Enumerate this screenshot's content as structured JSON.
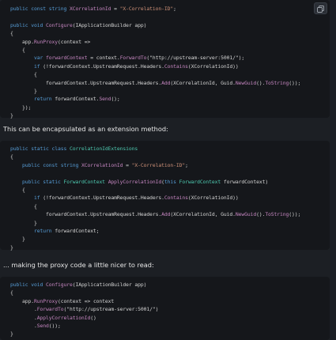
{
  "blocks": [
    {
      "lines": [
        [
          {
            "t": "public const string ",
            "k": "kw"
          },
          {
            "t": "XCorrelationId",
            "k": "member"
          },
          {
            "t": " = ",
            "k": "plain"
          },
          {
            "t": "\"X-Correlation-ID\"",
            "k": "str"
          },
          {
            "t": ";",
            "k": "plain"
          }
        ],
        [],
        [
          {
            "t": "public void ",
            "k": "kw"
          },
          {
            "t": "Configure",
            "k": "member"
          },
          {
            "t": "(IApplicationBuilder app)",
            "k": "plain"
          }
        ],
        [
          {
            "t": "{",
            "k": "plain"
          }
        ],
        [
          {
            "t": "    app.",
            "k": "plain"
          },
          {
            "t": "RunProxy",
            "k": "member"
          },
          {
            "t": "(context =>",
            "k": "plain"
          }
        ],
        [
          {
            "t": "    {",
            "k": "plain"
          }
        ],
        [
          {
            "t": "        var ",
            "k": "kw"
          },
          {
            "t": "forwardContext",
            "k": "member"
          },
          {
            "t": " = context.",
            "k": "plain"
          },
          {
            "t": "ForwardTo",
            "k": "member"
          },
          {
            "t": "(\"http://upstream-server:5001/\");",
            "k": "plain"
          }
        ],
        [
          {
            "t": "        if ",
            "k": "kw"
          },
          {
            "t": "(!forwardContext.UpstreamRequest.Headers.",
            "k": "plain"
          },
          {
            "t": "Contains",
            "k": "member"
          },
          {
            "t": "(XCorrelationId))",
            "k": "plain"
          }
        ],
        [
          {
            "t": "        {",
            "k": "plain"
          }
        ],
        [
          {
            "t": "            forwardContext.UpstreamRequest.Headers.",
            "k": "plain"
          },
          {
            "t": "Add",
            "k": "member"
          },
          {
            "t": "(XCorrelationId, Guid.",
            "k": "plain"
          },
          {
            "t": "NewGuid",
            "k": "member"
          },
          {
            "t": "().",
            "k": "plain"
          },
          {
            "t": "ToString",
            "k": "member"
          },
          {
            "t": "());",
            "k": "plain"
          }
        ],
        [
          {
            "t": "        }",
            "k": "plain"
          }
        ],
        [
          {
            "t": "        return ",
            "k": "kw"
          },
          {
            "t": "forwardContext.",
            "k": "plain"
          },
          {
            "t": "Send",
            "k": "member"
          },
          {
            "t": "();",
            "k": "plain"
          }
        ],
        [
          {
            "t": "    });",
            "k": "plain"
          }
        ],
        [
          {
            "t": "}",
            "k": "plain"
          }
        ]
      ]
    },
    {
      "lines": [
        [
          {
            "t": "public static class ",
            "k": "kw"
          },
          {
            "t": "CorrelationIdExtensions",
            "k": "type"
          }
        ],
        [
          {
            "t": "{",
            "k": "plain"
          }
        ],
        [
          {
            "t": "    public const string ",
            "k": "kw"
          },
          {
            "t": "XCorrelationId",
            "k": "member"
          },
          {
            "t": " = ",
            "k": "plain"
          },
          {
            "t": "\"X-Correlation-ID\"",
            "k": "str"
          },
          {
            "t": ";",
            "k": "plain"
          }
        ],
        [],
        [
          {
            "t": "    public static ",
            "k": "kw"
          },
          {
            "t": "ForwardContext ",
            "k": "type"
          },
          {
            "t": "ApplyCorrelationId",
            "k": "member"
          },
          {
            "t": "(",
            "k": "plain"
          },
          {
            "t": "this ",
            "k": "kw"
          },
          {
            "t": "ForwardContext ",
            "k": "type"
          },
          {
            "t": "forwardContext)",
            "k": "plain"
          }
        ],
        [
          {
            "t": "    {",
            "k": "plain"
          }
        ],
        [
          {
            "t": "        if ",
            "k": "kw"
          },
          {
            "t": "(!forwardContext.UpstreamRequest.Headers.",
            "k": "plain"
          },
          {
            "t": "Contains",
            "k": "member"
          },
          {
            "t": "(XCorrelationId))",
            "k": "plain"
          }
        ],
        [
          {
            "t": "        {",
            "k": "plain"
          }
        ],
        [
          {
            "t": "            forwardContext.UpstreamRequest.Headers.",
            "k": "plain"
          },
          {
            "t": "Add",
            "k": "member"
          },
          {
            "t": "(XCorrelationId, Guid.",
            "k": "plain"
          },
          {
            "t": "NewGuid",
            "k": "member"
          },
          {
            "t": "().",
            "k": "plain"
          },
          {
            "t": "ToString",
            "k": "member"
          },
          {
            "t": "());",
            "k": "plain"
          }
        ],
        [
          {
            "t": "        }",
            "k": "plain"
          }
        ],
        [
          {
            "t": "        return ",
            "k": "kw"
          },
          {
            "t": "forwardContext;",
            "k": "plain"
          }
        ],
        [
          {
            "t": "    }",
            "k": "plain"
          }
        ],
        [
          {
            "t": "}",
            "k": "plain"
          }
        ]
      ]
    },
    {
      "lines": [
        [
          {
            "t": "public void ",
            "k": "kw"
          },
          {
            "t": "Configure",
            "k": "member"
          },
          {
            "t": "(IApplicationBuilder app)",
            "k": "plain"
          }
        ],
        [
          {
            "t": "{",
            "k": "plain"
          }
        ],
        [
          {
            "t": "    app.",
            "k": "plain"
          },
          {
            "t": "RunProxy",
            "k": "member"
          },
          {
            "t": "(context => context",
            "k": "plain"
          }
        ],
        [
          {
            "t": "        .",
            "k": "plain"
          },
          {
            "t": "ForwardTo",
            "k": "member"
          },
          {
            "t": "(\"http://upstream-server:5001/\")",
            "k": "plain"
          }
        ],
        [
          {
            "t": "        .",
            "k": "plain"
          },
          {
            "t": "ApplyCorrelationId",
            "k": "member"
          },
          {
            "t": "()",
            "k": "plain"
          }
        ],
        [
          {
            "t": "        .",
            "k": "plain"
          },
          {
            "t": "Send",
            "k": "member"
          },
          {
            "t": "());",
            "k": "plain"
          }
        ],
        [
          {
            "t": "}",
            "k": "plain"
          }
        ]
      ]
    }
  ],
  "prose": [
    "This can be encapsulated as an extension method:",
    "... making the proxy code a little nicer to read:"
  ],
  "copy_button": {
    "icon": "copy-icon"
  },
  "colors": {
    "kw": "#569cd6",
    "type": "#4ec9b0",
    "member": "#c586c0",
    "str": "#ce9178",
    "plain": "#d4d4d4"
  }
}
